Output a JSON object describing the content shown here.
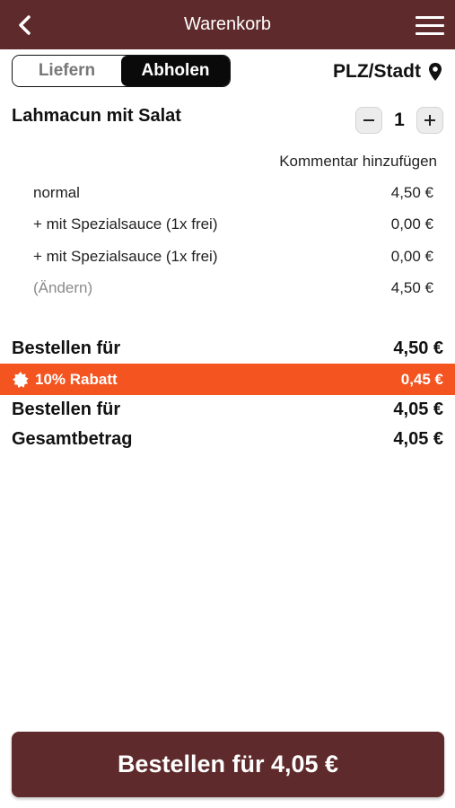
{
  "header": {
    "title": "Warenkorb"
  },
  "mode": {
    "deliver_label": "Liefern",
    "pickup_label": "Abholen",
    "active": "pickup"
  },
  "location": {
    "label": "PLZ/Stadt"
  },
  "item": {
    "name": "Lahmacun mit Salat",
    "quantity": "1",
    "comment_label": "Kommentar hinzufügen",
    "options": [
      {
        "label": "normal",
        "price": "4,50 €"
      },
      {
        "label": "+ mit Spezialsauce (1x frei)",
        "price": "0,00 €"
      },
      {
        "label": "+ mit Spezialsauce (1x frei)",
        "price": "0,00 €"
      },
      {
        "label": "(Ändern)",
        "price": "4,50 €"
      }
    ]
  },
  "summary": {
    "subtotal_label": "Bestellen für",
    "subtotal_value": "4,50 €",
    "discount_label": "10% Rabatt",
    "discount_value": "0,45 €",
    "after_discount_label": "Bestellen für",
    "after_discount_value": "4,05 €",
    "total_label": "Gesamtbetrag",
    "total_value": "4,05 €"
  },
  "order_button": {
    "label": "Bestellen für 4,05 €"
  },
  "icons": {
    "back": "chevron-left-icon",
    "menu": "hamburger-menu-icon",
    "location": "map-pin-icon",
    "discount": "badge-icon"
  },
  "colors": {
    "header": "#5e2a2b",
    "discount": "#f4541f",
    "button": "#5e2a2b"
  }
}
